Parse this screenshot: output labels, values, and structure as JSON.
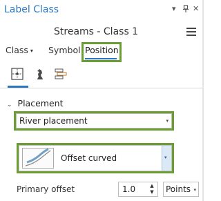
{
  "window": {
    "title": "Label Class",
    "controls": {
      "dropdown_glyph": "▾",
      "pin_glyph": "ᵖ",
      "close_glyph": "✕"
    }
  },
  "header": {
    "layer_class": "Streams - Class 1",
    "menu_icon": "hamburger-menu-icon"
  },
  "tabs": [
    {
      "label": "Class",
      "has_dropdown": true,
      "caret": "▾"
    },
    {
      "label": "Symbol",
      "has_dropdown": false
    },
    {
      "label": "Position",
      "active": true
    }
  ],
  "icon_tabs": [
    {
      "name": "position-placement-icon",
      "active": true
    },
    {
      "name": "conflict-resolution-icon",
      "active": false
    },
    {
      "name": "label-fitting-icon",
      "active": false
    }
  ],
  "placement": {
    "section_label": "Placement",
    "chevron": "⌄",
    "placement_type": "River placement",
    "caret": "▾",
    "style": {
      "label": "Offset curved",
      "caret": "▾"
    },
    "primary_offset": {
      "label": "Primary offset",
      "value": "1.0",
      "up": "▲",
      "down": "▼"
    },
    "unit": {
      "value": "Points",
      "caret": "▾"
    }
  },
  "colors": {
    "accent": "#2a77c0",
    "highlight_border": "#6a9d34",
    "curve_preview": "#6fa0c8"
  }
}
